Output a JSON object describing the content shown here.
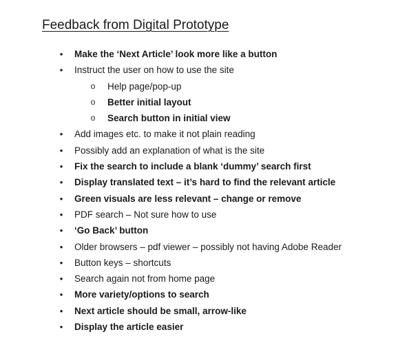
{
  "document": {
    "title": "Feedback from Digital Prototype",
    "items": [
      {
        "text": "Make the ‘Next Article’ look more like a button",
        "bold": true,
        "level": 1,
        "marker": "•"
      },
      {
        "text": "Instruct the user on how to use the site",
        "bold": false,
        "level": 1,
        "marker": "•"
      },
      {
        "text": "Help page/pop-up",
        "bold": false,
        "level": 2,
        "marker": "o"
      },
      {
        "text": "Better initial layout",
        "bold": true,
        "level": 2,
        "marker": "o"
      },
      {
        "text": "Search button in initial view",
        "bold": true,
        "level": 2,
        "marker": "o"
      },
      {
        "text": "Add images etc. to make it not plain reading",
        "bold": false,
        "level": 1,
        "marker": "•"
      },
      {
        "text": "Possibly add an explanation of what is the site",
        "bold": false,
        "level": 1,
        "marker": "•"
      },
      {
        "text": "Fix the search to include a blank ‘dummy’ search first",
        "bold": true,
        "level": 1,
        "marker": "•"
      },
      {
        "text": "Display translated text – it’s hard to find the relevant article",
        "bold": true,
        "level": 1,
        "marker": "•"
      },
      {
        "text": "Green visuals are less relevant – change or remove",
        "bold": true,
        "level": 1,
        "marker": "•"
      },
      {
        "text": "PDF search – Not sure how to use",
        "bold": false,
        "level": 1,
        "marker": "•"
      },
      {
        "text": "‘Go Back’ button",
        "bold": true,
        "level": 1,
        "marker": "•"
      },
      {
        "text": "Older browsers – pdf viewer – possibly not having Adobe Reader",
        "bold": false,
        "level": 1,
        "marker": "•"
      },
      {
        "text": "Button keys – shortcuts",
        "bold": false,
        "level": 1,
        "marker": "•"
      },
      {
        "text": "Search again not from home page",
        "bold": false,
        "level": 1,
        "marker": "•"
      },
      {
        "text": "More variety/options to search",
        "bold": true,
        "level": 1,
        "marker": "•"
      },
      {
        "text": "Next article should be small, arrow-like",
        "bold": true,
        "level": 1,
        "marker": "•"
      },
      {
        "text": "Display the article easier",
        "bold": true,
        "level": 1,
        "marker": "•"
      }
    ]
  }
}
